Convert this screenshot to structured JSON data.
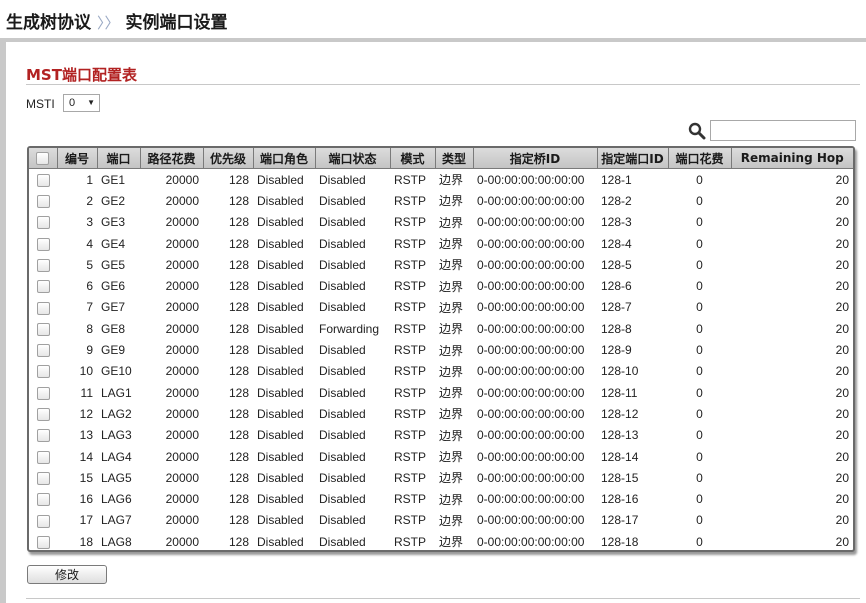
{
  "breadcrumb": {
    "parent": "生成树协议",
    "separator": "〉〉",
    "current": "实例端口设置"
  },
  "section": {
    "title": "MST端口配置表"
  },
  "msti": {
    "label": "MSTI",
    "value": "0"
  },
  "search": {
    "placeholder": "",
    "value": ""
  },
  "table": {
    "headers": [
      "",
      "编号",
      "端口",
      "路径花费",
      "优先级",
      "端口角色",
      "端口状态",
      "模式",
      "类型",
      "指定桥ID",
      "指定端口ID",
      "端口花费",
      "Remaining Hop"
    ],
    "rows": [
      [
        "1",
        "GE1",
        "20000",
        "128",
        "Disabled",
        "Disabled",
        "RSTP",
        "边界",
        "0-00:00:00:00:00:00",
        "128-1",
        "0",
        "20"
      ],
      [
        "2",
        "GE2",
        "20000",
        "128",
        "Disabled",
        "Disabled",
        "RSTP",
        "边界",
        "0-00:00:00:00:00:00",
        "128-2",
        "0",
        "20"
      ],
      [
        "3",
        "GE3",
        "20000",
        "128",
        "Disabled",
        "Disabled",
        "RSTP",
        "边界",
        "0-00:00:00:00:00:00",
        "128-3",
        "0",
        "20"
      ],
      [
        "4",
        "GE4",
        "20000",
        "128",
        "Disabled",
        "Disabled",
        "RSTP",
        "边界",
        "0-00:00:00:00:00:00",
        "128-4",
        "0",
        "20"
      ],
      [
        "5",
        "GE5",
        "20000",
        "128",
        "Disabled",
        "Disabled",
        "RSTP",
        "边界",
        "0-00:00:00:00:00:00",
        "128-5",
        "0",
        "20"
      ],
      [
        "6",
        "GE6",
        "20000",
        "128",
        "Disabled",
        "Disabled",
        "RSTP",
        "边界",
        "0-00:00:00:00:00:00",
        "128-6",
        "0",
        "20"
      ],
      [
        "7",
        "GE7",
        "20000",
        "128",
        "Disabled",
        "Disabled",
        "RSTP",
        "边界",
        "0-00:00:00:00:00:00",
        "128-7",
        "0",
        "20"
      ],
      [
        "8",
        "GE8",
        "20000",
        "128",
        "Disabled",
        "Forwarding",
        "RSTP",
        "边界",
        "0-00:00:00:00:00:00",
        "128-8",
        "0",
        "20"
      ],
      [
        "9",
        "GE9",
        "20000",
        "128",
        "Disabled",
        "Disabled",
        "RSTP",
        "边界",
        "0-00:00:00:00:00:00",
        "128-9",
        "0",
        "20"
      ],
      [
        "10",
        "GE10",
        "20000",
        "128",
        "Disabled",
        "Disabled",
        "RSTP",
        "边界",
        "0-00:00:00:00:00:00",
        "128-10",
        "0",
        "20"
      ],
      [
        "11",
        "LAG1",
        "20000",
        "128",
        "Disabled",
        "Disabled",
        "RSTP",
        "边界",
        "0-00:00:00:00:00:00",
        "128-11",
        "0",
        "20"
      ],
      [
        "12",
        "LAG2",
        "20000",
        "128",
        "Disabled",
        "Disabled",
        "RSTP",
        "边界",
        "0-00:00:00:00:00:00",
        "128-12",
        "0",
        "20"
      ],
      [
        "13",
        "LAG3",
        "20000",
        "128",
        "Disabled",
        "Disabled",
        "RSTP",
        "边界",
        "0-00:00:00:00:00:00",
        "128-13",
        "0",
        "20"
      ],
      [
        "14",
        "LAG4",
        "20000",
        "128",
        "Disabled",
        "Disabled",
        "RSTP",
        "边界",
        "0-00:00:00:00:00:00",
        "128-14",
        "0",
        "20"
      ],
      [
        "15",
        "LAG5",
        "20000",
        "128",
        "Disabled",
        "Disabled",
        "RSTP",
        "边界",
        "0-00:00:00:00:00:00",
        "128-15",
        "0",
        "20"
      ],
      [
        "16",
        "LAG6",
        "20000",
        "128",
        "Disabled",
        "Disabled",
        "RSTP",
        "边界",
        "0-00:00:00:00:00:00",
        "128-16",
        "0",
        "20"
      ],
      [
        "17",
        "LAG7",
        "20000",
        "128",
        "Disabled",
        "Disabled",
        "RSTP",
        "边界",
        "0-00:00:00:00:00:00",
        "128-17",
        "0",
        "20"
      ],
      [
        "18",
        "LAG8",
        "20000",
        "128",
        "Disabled",
        "Disabled",
        "RSTP",
        "边界",
        "0-00:00:00:00:00:00",
        "128-18",
        "0",
        "20"
      ]
    ]
  },
  "actions": {
    "modify_label": "修改"
  },
  "colors": {
    "section_title": "#b22222",
    "breadcrumb_separator": "#9aa9c4"
  },
  "icons": {
    "search": "search-icon",
    "dropdown": "chevron-down-icon"
  }
}
